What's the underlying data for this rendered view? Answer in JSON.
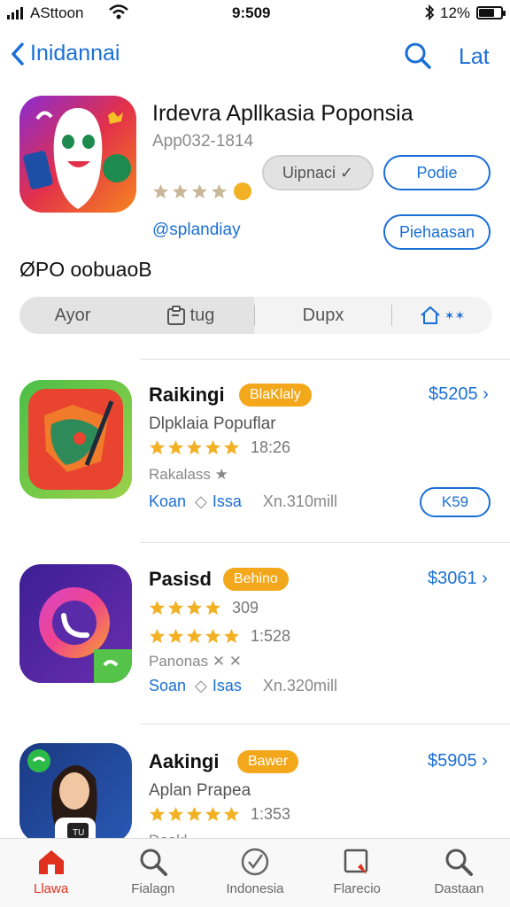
{
  "status_bar": {
    "carrier": "ASttoon",
    "time": "9:509",
    "battery_text": "12%",
    "battery_level": 0.7
  },
  "nav": {
    "back_label": "Inidannai",
    "right_label": "Lat"
  },
  "hero": {
    "title": "Irdevra Apllkasia Poponsia",
    "app_id": "App032-1814",
    "rating_stars": 4,
    "dev_link": "@splandiay",
    "buttons": {
      "grey": "Uipnaci ✓",
      "primary": "Podie",
      "secondary": "Piehaasan"
    }
  },
  "section_label": "ØPO oobuaoB",
  "segments": [
    {
      "label": "Ayor"
    },
    {
      "label": "tug"
    },
    {
      "label": "Dupx"
    },
    {
      "label": "✶✶"
    }
  ],
  "rows": [
    {
      "title": "Raikingi",
      "badge": "BlaKlaly",
      "price": "$5205 ›",
      "subtitle": "Dlpklaia Popuflar",
      "stars": 5,
      "rating_num": "18:26",
      "muted": "Rakalass ★",
      "meta_a": "Koan",
      "meta_b": "Issa",
      "meta_c": "Xn.310mill",
      "pill": "K59"
    },
    {
      "title": "Pasisd",
      "badge": "Behino",
      "price": "$3061 ›",
      "subtitle": "",
      "stars": 4,
      "rating_num": "309",
      "stars2": 5,
      "rating_num2": "1:528",
      "muted": "Panonas ✕ ✕",
      "meta_a": "Soan",
      "meta_b": "Isas",
      "meta_c": "Xn.320mill",
      "pill": ""
    },
    {
      "title": "Aakingi",
      "badge": "Bawer",
      "price": "$5905 ›",
      "subtitle": "Aplan Prapea",
      "stars": 5,
      "rating_num": "1:353",
      "muted": "Dookl",
      "meta_a": "",
      "meta_b": "",
      "meta_c": "",
      "pill": ""
    }
  ],
  "tabs": [
    {
      "label": "Llawa",
      "icon": "home-icon",
      "active": true
    },
    {
      "label": "Fialagn",
      "icon": "search-icon",
      "active": false
    },
    {
      "label": "Indonesia",
      "icon": "check-circle-icon",
      "active": false
    },
    {
      "label": "Flarecio",
      "icon": "edit-box-icon",
      "active": false
    },
    {
      "label": "Dastaan",
      "icon": "search-icon",
      "active": false
    }
  ],
  "colors": {
    "accent": "#1a6fd6",
    "badge": "#f3a81b",
    "star": "#f2b124",
    "active_tab": "#e0301e"
  }
}
